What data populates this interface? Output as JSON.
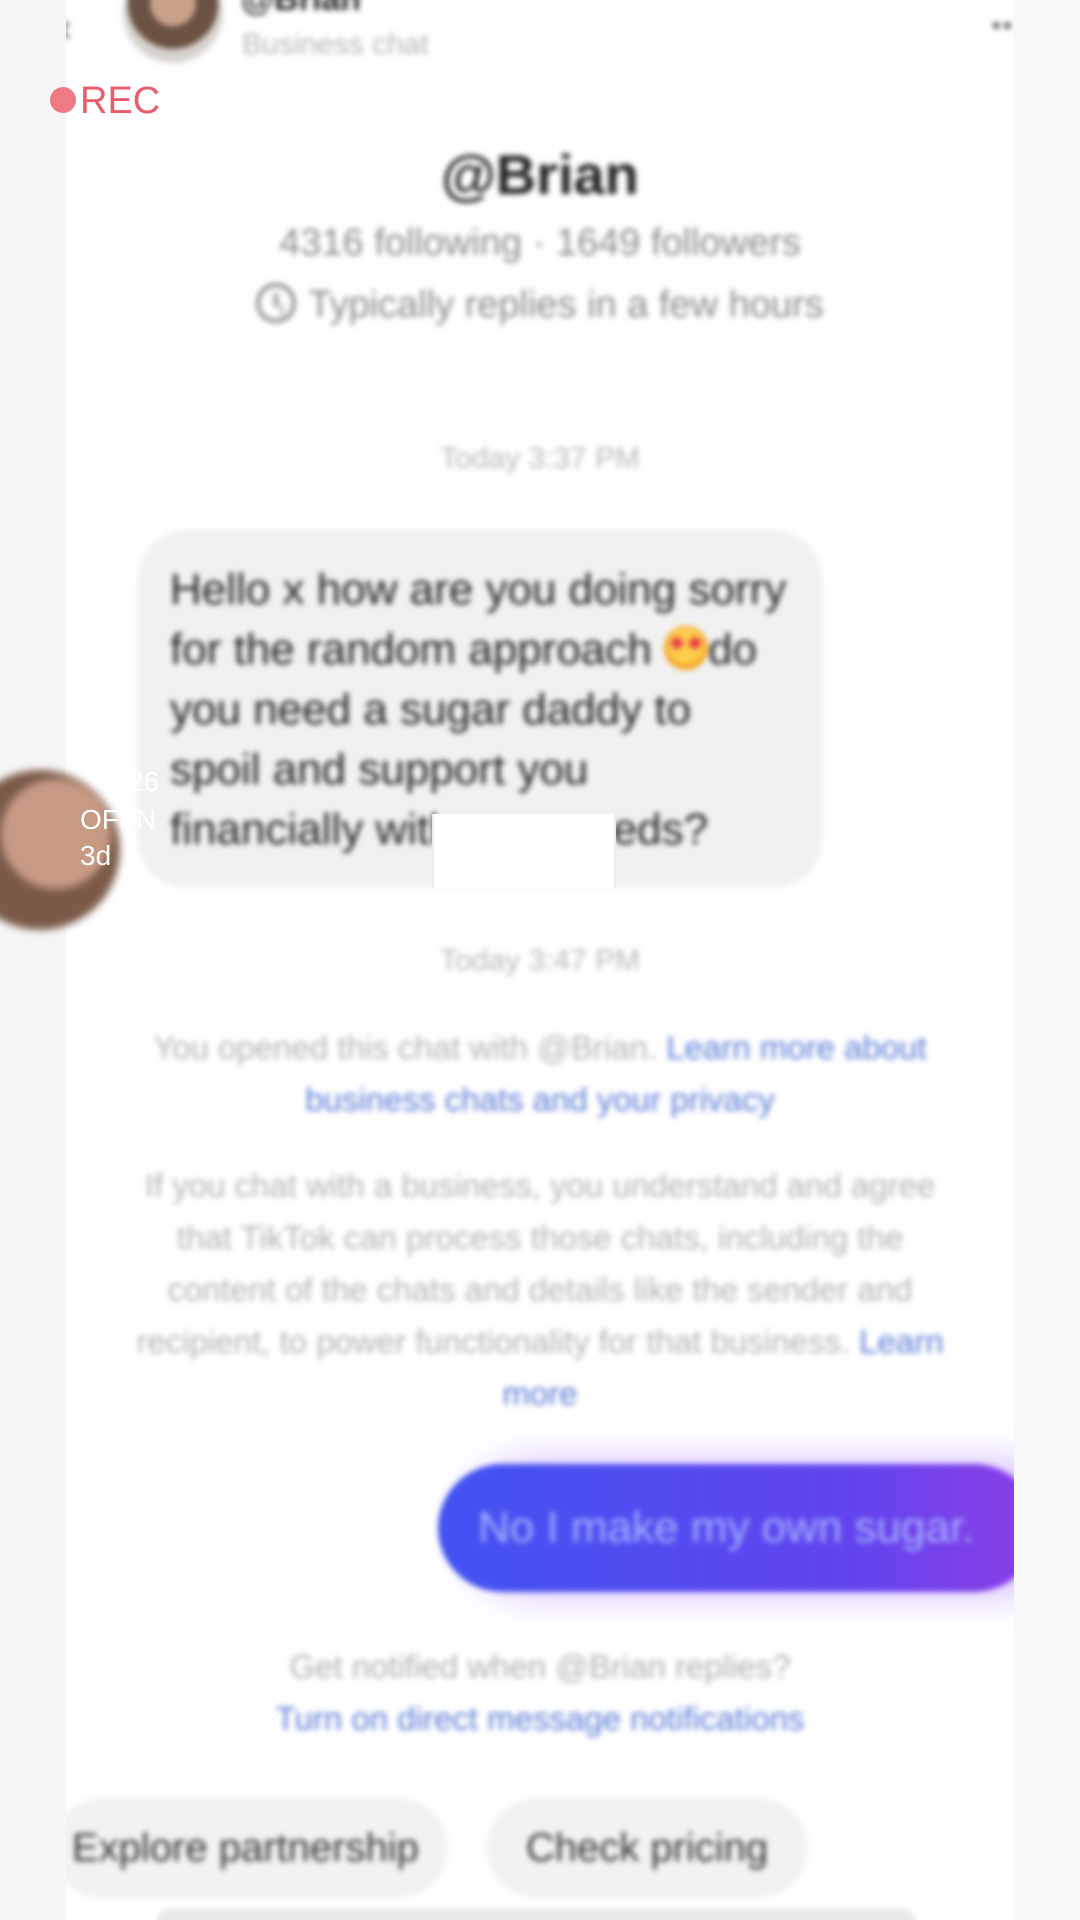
{
  "recording": {
    "label": "REC"
  },
  "header": {
    "handle": "@Brian",
    "subtitle": "Business chat",
    "more": "••"
  },
  "profile": {
    "name": "@Brian",
    "stats": "4316 following · 1649 followers",
    "reply_time": "Typically replies in a few hours"
  },
  "messages": [
    {
      "timestamp": "Today 3:37 PM"
    },
    {
      "text_part1": "Hello x how are you doing sorry for the random approach ",
      "text_part2": "do you need a sugar daddy to spoil and support you financially with your needs?"
    },
    {
      "timestamp": "Today 3:47 PM"
    }
  ],
  "notice": {
    "opened_text": "You opened this chat with @Brian.",
    "opened_link": "Learn more about business chats and your privacy",
    "policy_text": "If you chat with a business, you understand and agree that TikTok can process those chats, including the content of the chats and details like the sender and recipient, to power functionality for that business.",
    "policy_link": "Learn more"
  },
  "outgoing": {
    "text": "No I make my own sugar."
  },
  "notifications": {
    "question": "Get notified when @Brian replies?",
    "link": "Turn on direct message notifications"
  },
  "chips": [
    "Explore partnership",
    "Check pricing"
  ],
  "side_overlay": {
    "line1": "L",
    "line2": "26",
    "line3": "OFFN",
    "line4": "3d"
  },
  "colors": {
    "accent": "#4153f2",
    "rec": "#ea5b6c",
    "link": "#5a7bd6"
  }
}
